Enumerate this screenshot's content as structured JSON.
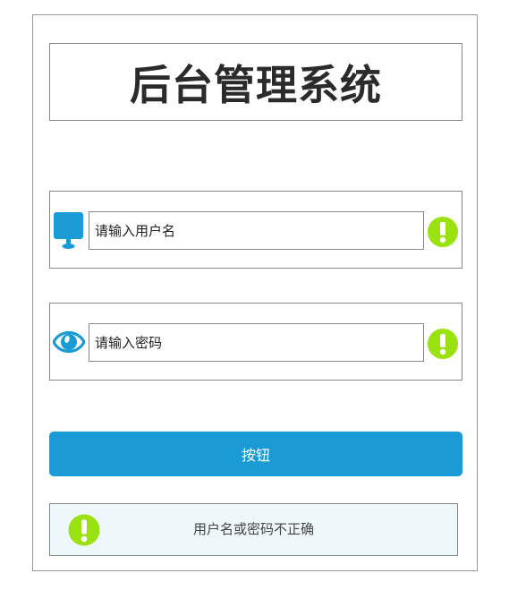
{
  "header": {
    "title": "后台管理系统"
  },
  "username": {
    "placeholder": "请输入用户名",
    "value": "",
    "icon": "monitor-icon",
    "status_icon": "warning-icon"
  },
  "password": {
    "placeholder": "请输入密码",
    "value": "",
    "icon": "eye-icon",
    "status_icon": "warning-icon"
  },
  "submit": {
    "label": "按钮"
  },
  "alert": {
    "icon": "warning-icon",
    "message": "用户名或密码不正确"
  },
  "colors": {
    "primary": "#1a9bd6",
    "icon_blue": "#1a9bd6",
    "warning_green": "#99e20f",
    "alert_bg": "#eef7fa",
    "border": "#888888"
  }
}
